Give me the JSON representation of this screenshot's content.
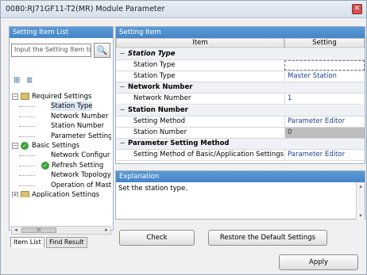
{
  "window": {
    "title": "0080:RJ71GF11-T2(MR) Module Parameter",
    "close_glyph": "✕"
  },
  "left": {
    "header": "Setting Item List",
    "search_placeholder": "Input the Setting Item to",
    "search_icon_glyph": "🔍",
    "tool_icon_a": "⊞",
    "tool_icon_b": "≣",
    "tree": [
      {
        "label": "Required Settings",
        "level": 1,
        "kind": "folder",
        "expanded": true
      },
      {
        "label": "Station Type",
        "level": 2,
        "kind": "leaf",
        "selected": true
      },
      {
        "label": "Network Number",
        "level": 2,
        "kind": "leaf"
      },
      {
        "label": "Station Number",
        "level": 2,
        "kind": "leaf"
      },
      {
        "label": "Parameter Setting",
        "level": 2,
        "kind": "leaf"
      },
      {
        "label": "Basic Settings",
        "level": 1,
        "kind": "check",
        "expanded": true
      },
      {
        "label": "Network Configur",
        "level": 2,
        "kind": "leaf"
      },
      {
        "label": "Refresh Setting",
        "level": 2,
        "kind": "check"
      },
      {
        "label": "Network Topology",
        "level": 2,
        "kind": "leaf"
      },
      {
        "label": "Operation of Mast",
        "level": 2,
        "kind": "leaf"
      },
      {
        "label": "Application Settings",
        "level": 1,
        "kind": "folder",
        "expanded": false
      }
    ],
    "hscroll_thumb": "III",
    "tabs": [
      "Item List",
      "Find Result"
    ]
  },
  "right": {
    "header": "Setting Item",
    "col_item": "Item",
    "col_setting": "Setting",
    "rows": [
      {
        "type": "group",
        "label": "Station Type",
        "italic": true
      },
      {
        "type": "item",
        "label": "Station Type",
        "value": "",
        "style": "dashed"
      },
      {
        "type": "item",
        "label": "Station Type",
        "value": "Master Station"
      },
      {
        "type": "group",
        "label": "Network Number"
      },
      {
        "type": "item",
        "label": "Network Number",
        "value": "1"
      },
      {
        "type": "group",
        "label": "Station Number"
      },
      {
        "type": "item",
        "label": "Setting Method",
        "value": "Parameter Editor"
      },
      {
        "type": "item",
        "label": "Station Number",
        "value": "0",
        "style": "gray"
      },
      {
        "type": "group",
        "label": "Parameter Setting Method"
      },
      {
        "type": "item",
        "label": "Setting Method of Basic/Application Settings",
        "value": "Parameter Editor"
      }
    ]
  },
  "explanation": {
    "header": "Explanation",
    "text": "Set the station type."
  },
  "buttons": {
    "check": "Check",
    "restore": "Restore the Default Settings",
    "apply": "Apply"
  }
}
